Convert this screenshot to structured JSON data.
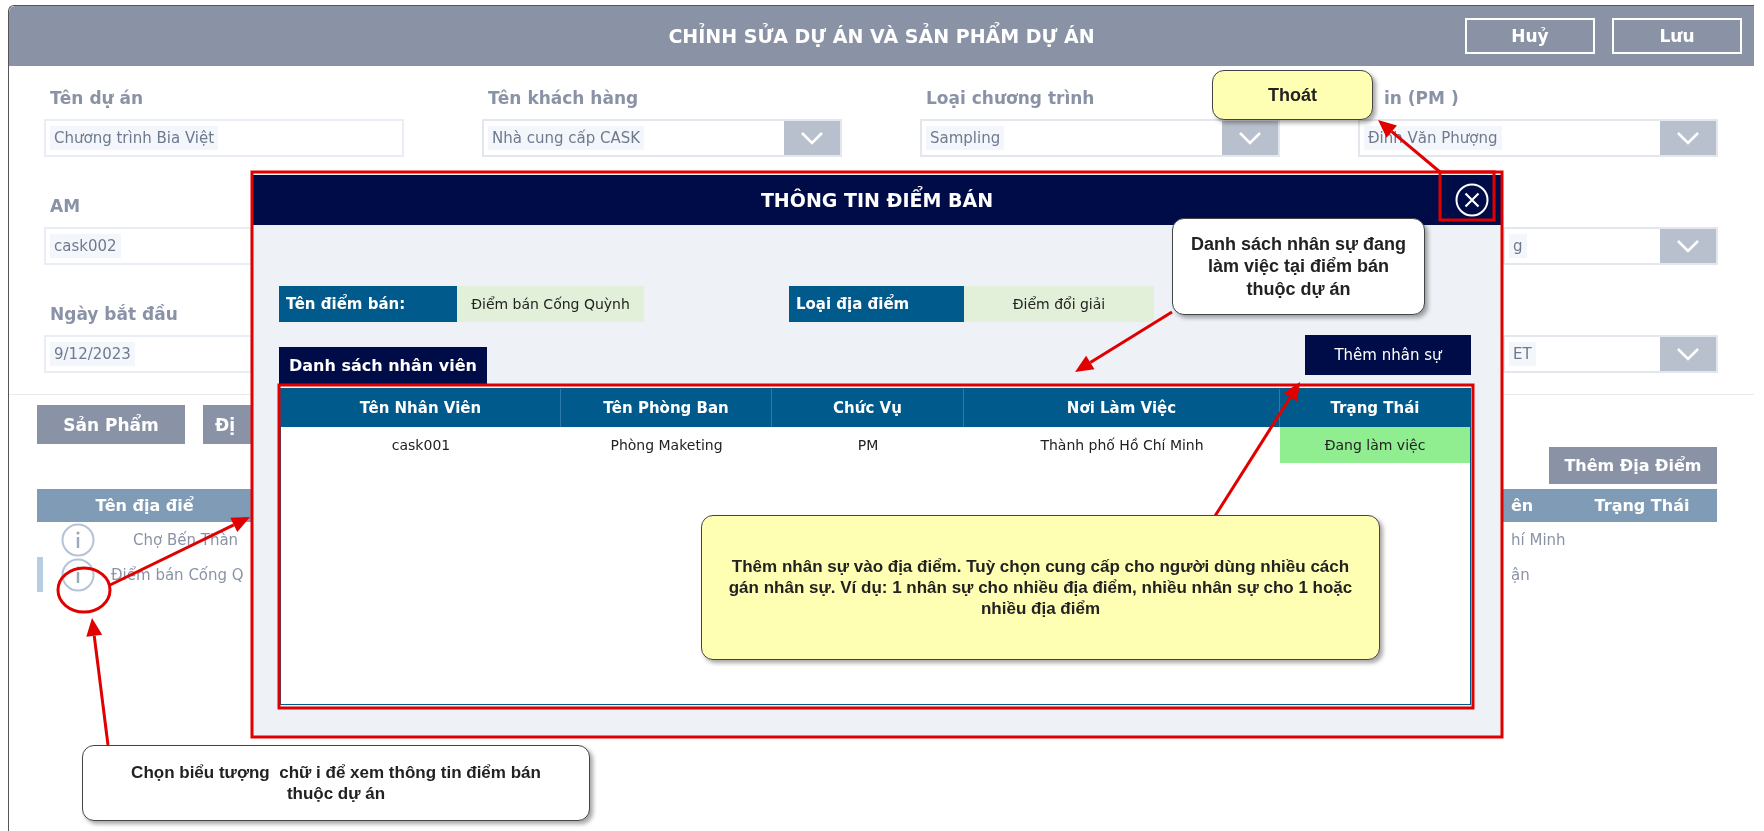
{
  "header": {
    "title": "CHỈNH SỬA DỰ ÁN VÀ SẢN PHẨM DỰ ÁN",
    "buttons": [
      "Huỷ",
      "Lưu"
    ]
  },
  "form": {
    "rows": [
      {
        "fields": [
          {
            "label": "Tên dự án",
            "kind": "input",
            "value": "Chương trình Bia Việt"
          },
          {
            "label": "Tên khách hàng",
            "kind": "dropdown",
            "value": "Nhà cung cấp CASK"
          },
          {
            "label": "Loại chương trình",
            "kind": "dropdown",
            "value": "Sampling"
          },
          {
            "label": "in (PM )",
            "kind": "dropdown",
            "value": "Đinh Văn Phượng"
          }
        ]
      },
      {
        "fields": [
          {
            "label": "AM",
            "kind": "input",
            "value": "cask002"
          },
          {
            "kind": "dropdown",
            "value": "g"
          }
        ]
      },
      {
        "fields": [
          {
            "label": "Ngày bắt đầu",
            "kind": "input",
            "value": "9/12/2023"
          },
          {
            "kind": "dropdown",
            "value": "ET"
          }
        ]
      }
    ]
  },
  "tabs": [
    {
      "label": "Sản Phẩm"
    },
    {
      "label": "Đị"
    }
  ],
  "locations": {
    "add_button": "Thêm Địa Điểm",
    "columns": [
      "Tên địa điể",
      "ên",
      "Trạng Thái"
    ],
    "rows": [
      {
        "cells": [
          "Chợ Bến Thàn",
          "hí Minh"
        ],
        "selected": false
      },
      {
        "cells": [
          "Điểm bán Cống Q",
          "ận"
        ],
        "selected": true
      }
    ]
  },
  "dialog": {
    "title": "THÔNG TIN ĐIỂM BÁN",
    "fields": [
      {
        "label": "Tên điểm bán:",
        "value": "Điểm bán Cống Quỳnh"
      },
      {
        "label": "Loại địa điểm",
        "value": "Điểm đổi giải"
      }
    ],
    "list_title": "Danh sách nhân viên",
    "add_button": "Thêm nhân sự",
    "columns": [
      "Tên Nhân Viên",
      "Tên Phòng Ban",
      "Chức Vụ",
      "Nơi Làm Việc",
      "Trạng Thái"
    ],
    "rows": [
      {
        "cells": [
          "cask001",
          "Phòng Maketing",
          "PM",
          "Thành phố Hồ Chí Minh",
          "Đang làm việc"
        ]
      }
    ]
  },
  "annotations": [
    {
      "text": "Thoát",
      "color": "#ffffb3"
    },
    {
      "text": "Danh sách nhân sự đang làm việc tại điểm bán thuộc dự án",
      "color": "#ffffff"
    },
    {
      "text": "Thêm nhân sự vào địa điểm. Tuỳ chọn cung cấp cho người dùng nhiều cách gán nhân sự. Ví dụ: 1 nhân sự cho nhiều địa điểm, nhiều nhân sự cho 1 hoặc nhiều địa điểm",
      "color": "#ffffb3"
    },
    {
      "text": "Chọn biểu tượng  chữ i để xem thông tin điểm bán thuộc dự án",
      "color": "#ffffff"
    }
  ]
}
